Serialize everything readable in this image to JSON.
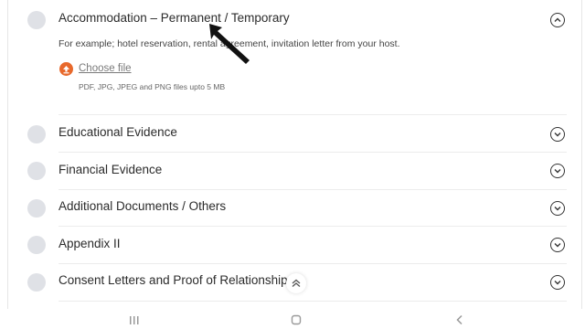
{
  "sections": [
    {
      "title": "Accommodation – Permanent / Temporary",
      "expanded": true
    },
    {
      "title": "Educational Evidence",
      "expanded": false
    },
    {
      "title": "Financial Evidence",
      "expanded": false
    },
    {
      "title": "Additional Documents / Others",
      "expanded": false
    },
    {
      "title": "Appendix II",
      "expanded": false
    },
    {
      "title": "Consent Letters and Proof of Relationship",
      "expanded": false
    }
  ],
  "expanded_section": {
    "description": "For example; hotel reservation, rental agreement, invitation letter from your host.",
    "choose_file_label": "Choose file",
    "file_hint": "PDF, JPG, JPEG and PNG files upto 5 MB"
  },
  "icons": {
    "status": "circle-icon",
    "upload": "upload-arrow-icon",
    "collapse": "chevron-up-icon",
    "expand": "chevron-down-icon",
    "scroll_top": "double-chevron-up-icon",
    "nav_recent": "recent-apps-icon",
    "nav_home": "home-icon",
    "nav_back": "back-icon",
    "cursor": "mouse-pointer-icon"
  },
  "colors": {
    "accent": "#e8692c",
    "status_circle": "#dfe1e6",
    "text": "#2b2b2b"
  }
}
